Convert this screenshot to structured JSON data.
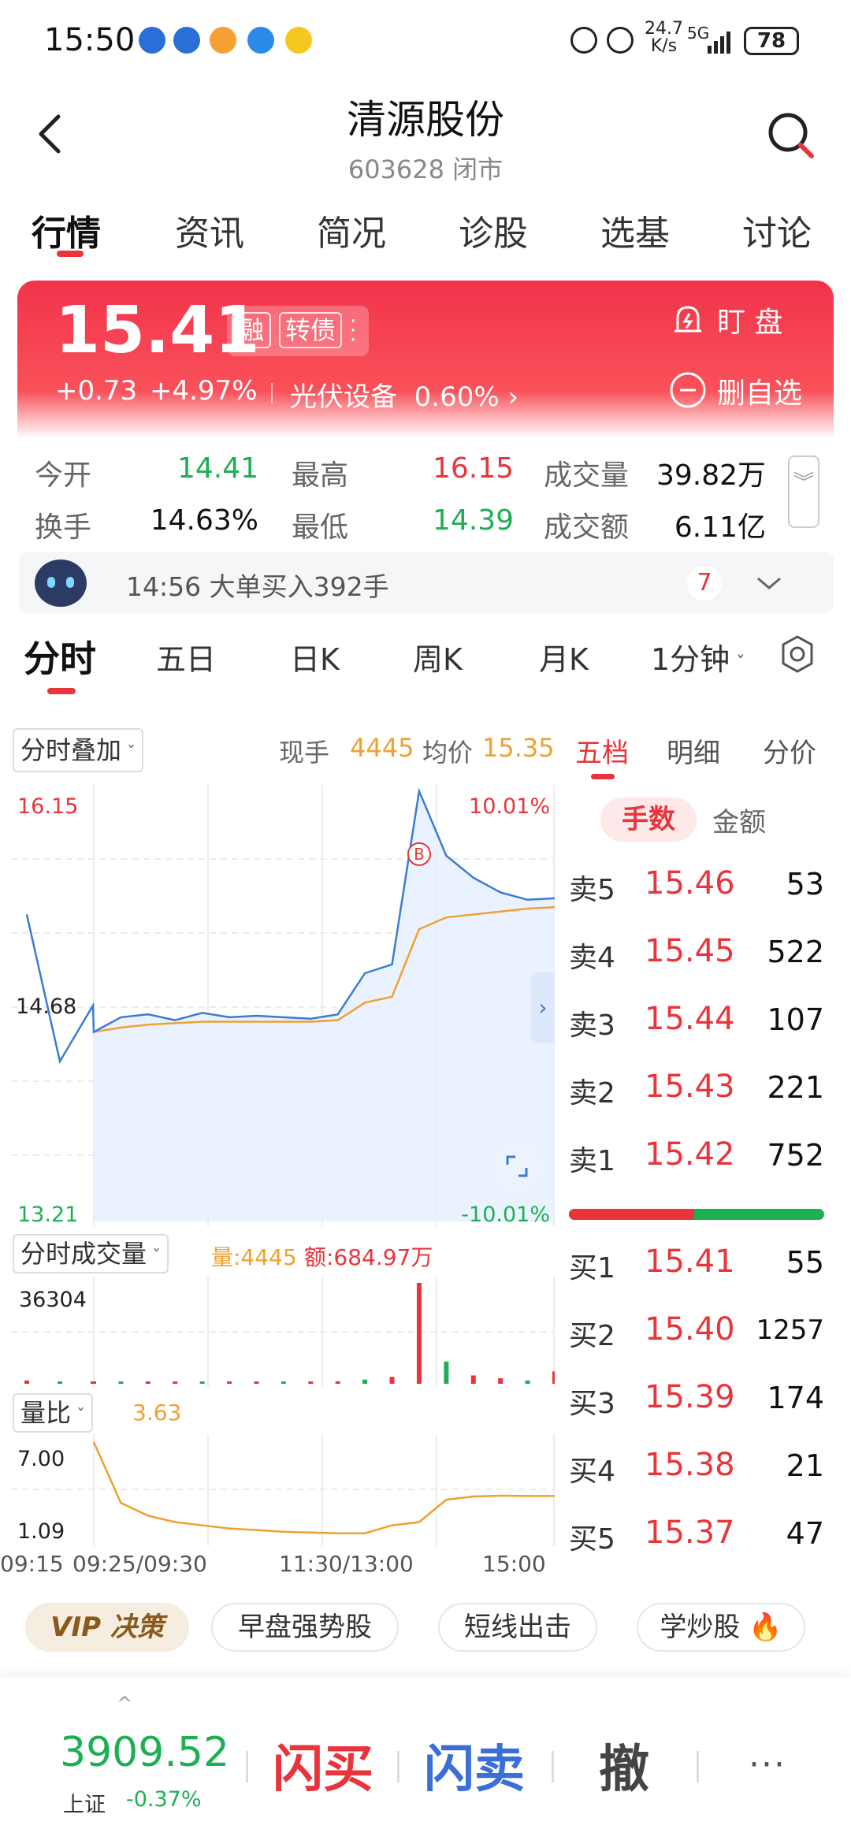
{
  "status_bar": {
    "time": "15:50",
    "net_speed_top": "24.7",
    "net_speed_bottom": "K/s",
    "network": "5G",
    "battery": "78"
  },
  "header": {
    "title": "清源股份",
    "subtitle": "603628 闭市"
  },
  "tabs": [
    {
      "label": "行情"
    },
    {
      "label": "资讯"
    },
    {
      "label": "简况"
    },
    {
      "label": "诊股"
    },
    {
      "label": "选基"
    },
    {
      "label": "讨论"
    }
  ],
  "price_card": {
    "price": "15.41",
    "badges": [
      "融",
      "转债"
    ],
    "change": "+0.73",
    "change_pct": "+4.97%",
    "sector": "光伏设备",
    "sector_pct": "0.60%",
    "watch_label": "盯 盘",
    "remove_label": "删自选"
  },
  "quote": {
    "open_label": "今开",
    "open": "14.41",
    "high_label": "最高",
    "high": "16.15",
    "volume_label": "成交量",
    "volume": "39.82万",
    "turnover_label": "换手",
    "turnover": "14.63%",
    "low_label": "最低",
    "low": "14.39",
    "amount_label": "成交额",
    "amount": "6.11亿"
  },
  "news_banner": {
    "text": "14:56 大单买入392手",
    "count": "7"
  },
  "period_tabs": [
    {
      "label": "分时"
    },
    {
      "label": "五日"
    },
    {
      "label": "日K"
    },
    {
      "label": "周K"
    },
    {
      "label": "月K"
    },
    {
      "label": "1分钟"
    }
  ],
  "chart_header": {
    "overlay_select": "分时叠加",
    "now_label": "现手",
    "now_value": "4445",
    "avg_label": "均价",
    "avg_value": "15.35"
  },
  "right_tabs": [
    {
      "label": "五档"
    },
    {
      "label": "明细"
    },
    {
      "label": "分价"
    }
  ],
  "order_toggle": {
    "active": "手数",
    "inactive": "金额"
  },
  "order_book": {
    "asks": [
      {
        "label": "卖5",
        "price": "15.46",
        "volume": "53"
      },
      {
        "label": "卖4",
        "price": "15.45",
        "volume": "522"
      },
      {
        "label": "卖3",
        "price": "15.44",
        "volume": "107"
      },
      {
        "label": "卖2",
        "price": "15.43",
        "volume": "221"
      },
      {
        "label": "卖1",
        "price": "15.42",
        "volume": "752"
      }
    ],
    "bids": [
      {
        "label": "买1",
        "price": "15.41",
        "volume": "55"
      },
      {
        "label": "买2",
        "price": "15.40",
        "volume": "1257"
      },
      {
        "label": "买3",
        "price": "15.39",
        "volume": "174"
      },
      {
        "label": "买4",
        "price": "15.38",
        "volume": "21"
      },
      {
        "label": "买5",
        "price": "15.37",
        "volume": "47"
      }
    ],
    "buy_ratio": 0.49
  },
  "volume_panel": {
    "select": "分时成交量",
    "vol_label": "量:4445",
    "amt_label": "额:684.97万",
    "max_label": "36304"
  },
  "ratio_panel": {
    "select": "量比",
    "value": "3.63",
    "top_label": "7.00",
    "bottom_label": "1.09"
  },
  "time_axis": [
    "09:15",
    "09:25/09:30",
    "11:30/13:00",
    "15:00"
  ],
  "chips": [
    {
      "label": "VIP 决策"
    },
    {
      "label": "早盘强势股"
    },
    {
      "label": "短线出击"
    },
    {
      "label": "学炒股"
    }
  ],
  "bottom_bar": {
    "index_value": "3909.52",
    "index_name": "上证",
    "index_change": "-0.37%",
    "buy_label": "闪买",
    "sell_label": "闪卖",
    "cancel_label": "撤",
    "more_label": "···"
  },
  "colors": {
    "up": "#e8343a",
    "down": "#1cb053",
    "price_line": "#3a7bd5",
    "avg_line": "#f0a030"
  },
  "chart_data": [
    {
      "type": "line",
      "ylim": [
        13.21,
        16.15
      ],
      "ytick_labels": [
        "16.15",
        "14.68",
        "13.21"
      ],
      "right_labels": [
        "10.01%",
        "-10.01%"
      ],
      "x": [
        "09:15",
        "09:20",
        "09:25",
        "09:30",
        "09:45",
        "10:00",
        "10:15",
        "10:30",
        "10:45",
        "11:00",
        "11:15",
        "11:30",
        "13:15",
        "13:30",
        "13:45",
        "14:00",
        "14:10",
        "14:20",
        "14:30",
        "14:45",
        "15:00"
      ],
      "series": [
        {
          "values": [
            15.3,
            14.3,
            14.68,
            14.5,
            14.6,
            14.62,
            14.58,
            14.63,
            14.6,
            14.61,
            14.6,
            14.59,
            14.62,
            14.9,
            14.96,
            16.14,
            15.7,
            15.55,
            15.45,
            15.4,
            15.41
          ]
        },
        {
          "values": [
            null,
            null,
            null,
            14.5,
            14.53,
            14.55,
            14.56,
            14.57,
            14.57,
            14.57,
            14.57,
            14.57,
            14.58,
            14.7,
            14.74,
            15.2,
            15.28,
            15.3,
            15.32,
            15.34,
            15.35
          ]
        }
      ],
      "annotation": "B"
    },
    {
      "type": "bar",
      "title": "分时成交量",
      "ylim": [
        0,
        36304
      ],
      "values": [
        1200,
        300,
        200,
        400,
        800,
        500,
        300,
        600,
        400,
        500,
        350,
        800,
        900,
        1500,
        2500,
        36304,
        8000,
        3000,
        2000,
        1200,
        4445
      ]
    },
    {
      "type": "line",
      "title": "量比",
      "ylim": [
        1.09,
        7.0
      ],
      "series": [
        {
          "values": [
            null,
            null,
            null,
            7.0,
            3.2,
            2.4,
            2.0,
            1.8,
            1.6,
            1.5,
            1.4,
            1.35,
            1.3,
            1.3,
            1.8,
            2.0,
            3.4,
            3.6,
            3.65,
            3.63,
            3.63
          ]
        }
      ]
    }
  ]
}
